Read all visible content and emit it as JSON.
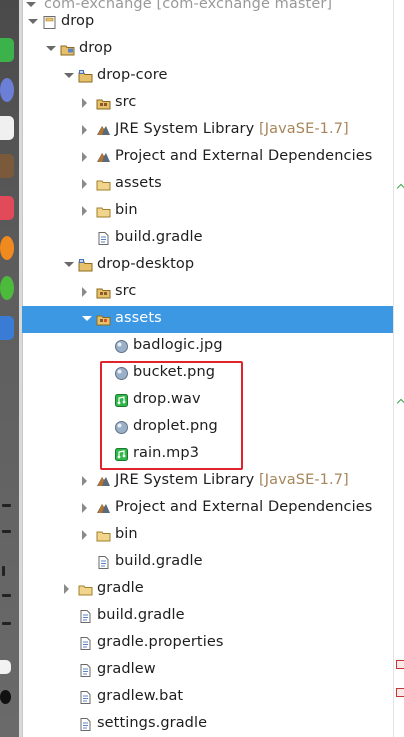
{
  "header": {
    "cut_text": "com-exchange [com-exchange master]"
  },
  "tree": [
    {
      "label": "drop",
      "icon": "project-folder-icon",
      "depth": 0,
      "state": "open"
    },
    {
      "label": "drop",
      "icon": "package-folder-icon",
      "depth": 1,
      "state": "open"
    },
    {
      "label": "drop-core",
      "icon": "java-project-icon",
      "depth": 2,
      "state": "open"
    },
    {
      "label": "src",
      "icon": "source-folder-icon",
      "depth": 3,
      "state": "closed"
    },
    {
      "label": "JRE System Library",
      "decoration": "[JavaSE-1.7]",
      "icon": "library-icon",
      "depth": 3,
      "state": "closed"
    },
    {
      "label": "Project and External Dependencies",
      "icon": "library-icon",
      "depth": 3,
      "state": "closed"
    },
    {
      "label": "assets",
      "icon": "folder-icon",
      "depth": 3,
      "state": "closed"
    },
    {
      "label": "bin",
      "icon": "folder-icon",
      "depth": 3,
      "state": "closed"
    },
    {
      "label": "build.gradle",
      "icon": "file-icon",
      "depth": 3,
      "state": "leaf"
    },
    {
      "label": "drop-desktop",
      "icon": "java-project-icon",
      "depth": 2,
      "state": "open"
    },
    {
      "label": "src",
      "icon": "source-folder-icon",
      "depth": 3,
      "state": "closed"
    },
    {
      "label": "assets",
      "icon": "linked-source-folder-icon",
      "depth": 3,
      "state": "open",
      "selected": true
    },
    {
      "label": "badlogic.jpg",
      "icon": "image-file-icon",
      "depth": 4,
      "state": "leaf"
    },
    {
      "label": "bucket.png",
      "icon": "image-file-icon",
      "depth": 4,
      "state": "leaf"
    },
    {
      "label": "drop.wav",
      "icon": "audio-file-icon",
      "depth": 4,
      "state": "leaf"
    },
    {
      "label": "droplet.png",
      "icon": "image-file-icon",
      "depth": 4,
      "state": "leaf"
    },
    {
      "label": "rain.mp3",
      "icon": "audio-file-icon",
      "depth": 4,
      "state": "leaf"
    },
    {
      "label": "JRE System Library",
      "decoration": "[JavaSE-1.7]",
      "icon": "library-icon",
      "depth": 3,
      "state": "closed"
    },
    {
      "label": "Project and External Dependencies",
      "icon": "library-icon",
      "depth": 3,
      "state": "closed"
    },
    {
      "label": "bin",
      "icon": "folder-icon",
      "depth": 3,
      "state": "closed"
    },
    {
      "label": "build.gradle",
      "icon": "file-icon",
      "depth": 3,
      "state": "leaf"
    },
    {
      "label": "gradle",
      "icon": "folder-icon",
      "depth": 2,
      "state": "closed"
    },
    {
      "label": "build.gradle",
      "icon": "file-icon",
      "depth": 2,
      "state": "leaf"
    },
    {
      "label": "gradle.properties",
      "icon": "file-icon",
      "depth": 2,
      "state": "leaf"
    },
    {
      "label": "gradlew",
      "icon": "file-icon",
      "depth": 2,
      "state": "leaf"
    },
    {
      "label": "gradlew.bat",
      "icon": "file-icon",
      "depth": 2,
      "state": "leaf"
    },
    {
      "label": "settings.gradle",
      "icon": "file-icon",
      "depth": 2,
      "state": "leaf"
    }
  ],
  "colors": {
    "selection": "#3d98e3",
    "highlight_box": "#e0232c",
    "decoration_text": "#a6865a"
  }
}
